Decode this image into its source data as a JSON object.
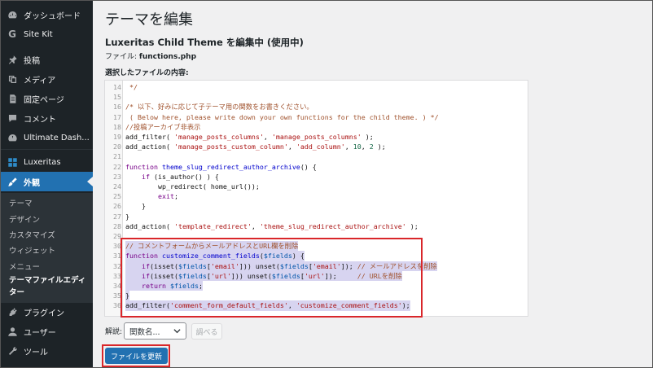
{
  "sidebar": {
    "items": [
      {
        "label": "ダッシュボード",
        "icon": "dashboard-icon"
      },
      {
        "label": "Site Kit",
        "icon": "site-kit-icon"
      },
      {
        "label": "投稿",
        "icon": "pin-icon"
      },
      {
        "label": "メディア",
        "icon": "media-icon"
      },
      {
        "label": "固定ページ",
        "icon": "page-icon"
      },
      {
        "label": "コメント",
        "icon": "comment-icon"
      },
      {
        "label": "Ultimate Dash...",
        "icon": "ultimate-dashboard-icon"
      },
      {
        "label": "Luxeritas",
        "icon": "luxeritas-icon"
      },
      {
        "label": "外観",
        "icon": "appearance-icon"
      },
      {
        "label": "プラグイン",
        "icon": "plugin-icon"
      },
      {
        "label": "ユーザー",
        "icon": "user-icon"
      },
      {
        "label": "ツール",
        "icon": "tool-icon"
      }
    ],
    "submenu": [
      "テーマ",
      "デザイン",
      "カスタマイズ",
      "ウィジェット",
      "メニュー",
      "テーマファイルエディ",
      "ター"
    ],
    "colors": {
      "bg": "#1d2327",
      "active": "#2271b1",
      "submenu_bg": "#2c3338"
    }
  },
  "main": {
    "title": "テーマを編集",
    "theme_heading": "Luxeritas Child Theme を編集中 (使用中)",
    "file_label": "ファイル:",
    "file_name": "functions.php",
    "content_label": "選択したファイルの内容:",
    "code_lines": [
      {
        "n": "14",
        "t": " */"
      },
      {
        "n": "15",
        "t": ""
      },
      {
        "n": "16",
        "t": "/* 以下、好みに応じて子テーマ用の関数をお書きください。"
      },
      {
        "n": "17",
        "t": " ( Below here, please write down your own functions for the child theme. ) */"
      },
      {
        "n": "18",
        "t": "//投稿アーカイブ非表示"
      },
      {
        "n": "19",
        "t": "add_filter( 'manage_posts_columns', 'manage_posts_columns' );"
      },
      {
        "n": "20",
        "t": "add_action( 'manage_posts_custom_column', 'add_column', 10, 2 );"
      },
      {
        "n": "21",
        "t": ""
      },
      {
        "n": "22",
        "t": "function theme_slug_redirect_author_archive() {"
      },
      {
        "n": "23",
        "t": "    if (is_author() ) {"
      },
      {
        "n": "24",
        "t": "        wp_redirect( home_url());"
      },
      {
        "n": "25",
        "t": "        exit;"
      },
      {
        "n": "26",
        "t": "    }"
      },
      {
        "n": "27",
        "t": "}"
      },
      {
        "n": "28",
        "t": "add_action( 'template_redirect', 'theme_slug_redirect_author_archive' );"
      },
      {
        "n": "29",
        "t": ""
      },
      {
        "n": "30",
        "t": "// コメントフォームからメールアドレスとURL欄を削除"
      },
      {
        "n": "31",
        "t": "function customize_comment_fields($fields) {"
      },
      {
        "n": "32",
        "t": "    if(isset($fields['email'])) unset($fields['email']); // メールアドレスを削除"
      },
      {
        "n": "33",
        "t": "    if(isset($fields['url'])) unset($fields['url']);     // URLを削除"
      },
      {
        "n": "34",
        "t": "    return $fields;"
      },
      {
        "n": "35",
        "t": "}"
      },
      {
        "n": "36",
        "t": "add_filter('comment_form_default_fields', 'customize_comment_fields');"
      }
    ],
    "docs_label": "解説:",
    "docs_select_value": "関数名...",
    "lookup_label": "調べる",
    "update_label": "ファイルを更新",
    "colors": {
      "highlight": "#d9262a",
      "primary": "#2271b1",
      "selection": "#d7d4f0"
    }
  }
}
